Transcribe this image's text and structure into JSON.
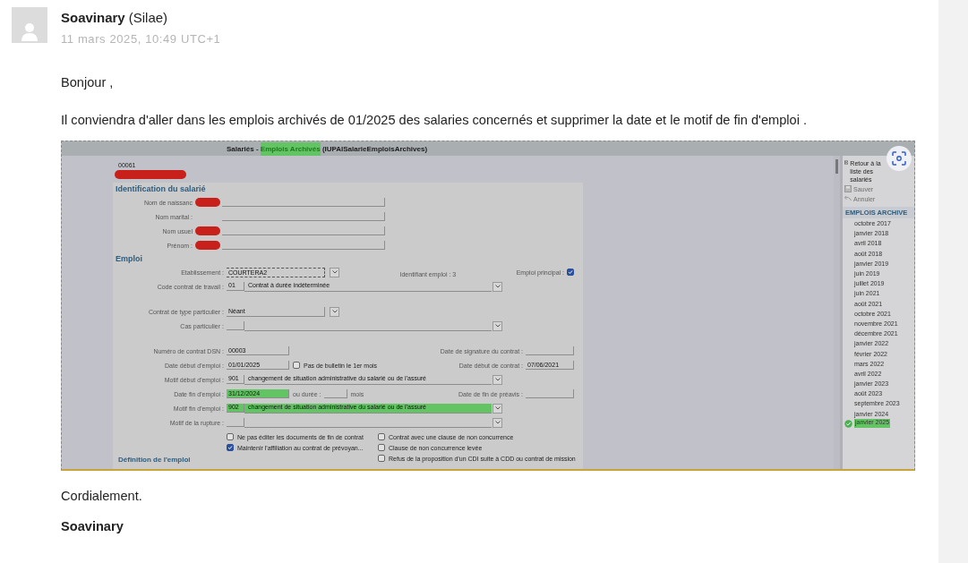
{
  "post": {
    "author": "Soavinary",
    "org": "(Silae)",
    "date": "11 mars 2025, 10:49 UTC+1",
    "greeting": "Bonjour ,",
    "paragraph": "Il conviendra d'aller dans les emplois archivés de 01/2025 des salaries concernés et supprimer la date et le motif de fin d'emploi .",
    "closing": "Cordialement.",
    "signature": "Soavinary"
  },
  "screenshot": {
    "title_parts": [
      {
        "text": "Salariés - ",
        "highlighted": false
      },
      {
        "text": "Emplois Archivés",
        "highlighted": true
      },
      {
        "text": " (IUPAISalarieEmploisArchives)",
        "highlighted": false
      }
    ],
    "employee_code": "00061",
    "employee_name_redacted": true,
    "identification": {
      "title": "Identification du salarié",
      "fields": [
        {
          "label": "Nom de naissanc",
          "redacted": true
        },
        {
          "label": "Nom marital :",
          "redacted": false
        },
        {
          "label": "Nom usuel",
          "redacted": true
        },
        {
          "label": "Prénom :",
          "redacted": true
        }
      ]
    },
    "emploi": {
      "title": "Emploi",
      "groups": [
        [
          {
            "label": "Etablissement :",
            "controls": [
              {
                "kind": "select",
                "value": "COURTERA2",
                "focused": true
              },
              {
                "kind": "note",
                "text": "Identifiant emploi : 3"
              },
              {
                "kind": "flag",
                "label": "Emploi principal :",
                "checked": true
              }
            ]
          },
          {
            "label": "Code contrat de travail :",
            "controls": [
              {
                "kind": "combo",
                "code": "01",
                "text": "Contrat à durée indéterminée",
                "code_highlighted": false,
                "text_highlighted": false
              }
            ]
          }
        ],
        [
          {
            "label": "Contrat de type particulier :",
            "controls": [
              {
                "kind": "select",
                "value": "Néant",
                "focused": false
              }
            ]
          },
          {
            "label": "Cas particulier :",
            "controls": [
              {
                "kind": "combo",
                "code_highlighted": false,
                "text_highlighted": false
              }
            ]
          }
        ],
        [
          {
            "label": "Numéro de contrat DSN :",
            "controls": [
              {
                "kind": "input",
                "value": "00003",
                "highlighted": false
              },
              {
                "kind": "side",
                "label": "Date de signature du contrat :"
              }
            ]
          },
          {
            "label": "Date début d'emploi :",
            "controls": [
              {
                "kind": "input",
                "value": "01/01/2025",
                "highlighted": false
              },
              {
                "kind": "check",
                "label": "Pas de bulletin le 1er mois",
                "checked": false
              },
              {
                "kind": "side",
                "label": "Date début de contrat :",
                "value": "07/06/2021"
              }
            ]
          },
          {
            "label": "Motif début d'emploi :",
            "controls": [
              {
                "kind": "combo",
                "code": "901",
                "text": "changement de situation administrative du salarié ou de l'assuré",
                "code_highlighted": false,
                "text_highlighted": false
              }
            ]
          },
          {
            "label": "Date fin d'emploi :",
            "controls": [
              {
                "kind": "input",
                "value": "31/12/2024",
                "highlighted": true
              },
              {
                "kind": "inline",
                "label": "ou durée :"
              },
              {
                "kind": "note",
                "text": "mois"
              },
              {
                "kind": "side",
                "label": "Date de fin de préavis :"
              }
            ]
          },
          {
            "label": "Motif fin d'emploi :",
            "controls": [
              {
                "kind": "combo",
                "code": "902",
                "text": "changement de situation administrative du salarié ou de l'assuré",
                "code_highlighted": true,
                "text_highlighted": true
              }
            ]
          },
          {
            "label": "Motif de la rupture :",
            "controls": [
              {
                "kind": "combo",
                "code_highlighted": false,
                "text_highlighted": false
              }
            ]
          }
        ]
      ],
      "option_columns": [
        [
          {
            "label": "Ne pas éditer les documents de fin de contrat",
            "checked": false
          },
          {
            "label": "Maintenir l'affiliation au contrat de prévoyan...",
            "checked": true
          }
        ],
        [
          {
            "label": "Contrat avec une clause de non concurrence",
            "checked": false
          },
          {
            "label": "Clause de non concurrence levée",
            "checked": false
          },
          {
            "label": "Refus de la proposition d'un CDI suite à CDD ou contrat de mission",
            "checked": false
          }
        ]
      ],
      "next_title": "Définition de l'emploi"
    },
    "sidebar": {
      "actions": [
        {
          "kind": "back",
          "label": "Retour à la liste des salariés",
          "disabled": false
        },
        {
          "kind": "save",
          "label": "Sauver",
          "disabled": true
        },
        {
          "kind": "undo",
          "label": "Annuler",
          "disabled": true
        }
      ],
      "heading": "EMPLOIS ARCHIVE",
      "periods": [
        {
          "label": "octobre 2017",
          "current": false,
          "highlighted": false
        },
        {
          "label": "janvier 2018",
          "current": false,
          "highlighted": false
        },
        {
          "label": "avril 2018",
          "current": false,
          "highlighted": false
        },
        {
          "label": "août 2018",
          "current": false,
          "highlighted": false
        },
        {
          "label": "janvier 2019",
          "current": false,
          "highlighted": false
        },
        {
          "label": "juin 2019",
          "current": false,
          "highlighted": false
        },
        {
          "label": "juillet 2019",
          "current": false,
          "highlighted": false
        },
        {
          "label": "juin 2021",
          "current": false,
          "highlighted": false
        },
        {
          "label": "août 2021",
          "current": false,
          "highlighted": false
        },
        {
          "label": "octobre 2021",
          "current": false,
          "highlighted": false
        },
        {
          "label": "novembre 2021",
          "current": false,
          "highlighted": false
        },
        {
          "label": "décembre 2021",
          "current": false,
          "highlighted": false
        },
        {
          "label": "janvier 2022",
          "current": false,
          "highlighted": false
        },
        {
          "label": "février 2022",
          "current": false,
          "highlighted": false
        },
        {
          "label": "mars 2022",
          "current": false,
          "highlighted": false
        },
        {
          "label": "avril 2022",
          "current": false,
          "highlighted": false
        },
        {
          "label": "janvier 2023",
          "current": false,
          "highlighted": false
        },
        {
          "label": "août 2023",
          "current": false,
          "highlighted": false
        },
        {
          "label": "septembre 2023",
          "current": false,
          "highlighted": false
        },
        {
          "label": "janvier 2024",
          "current": false,
          "highlighted": false
        },
        {
          "label": "janvier 2025",
          "current": true,
          "highlighted": true
        }
      ]
    }
  }
}
